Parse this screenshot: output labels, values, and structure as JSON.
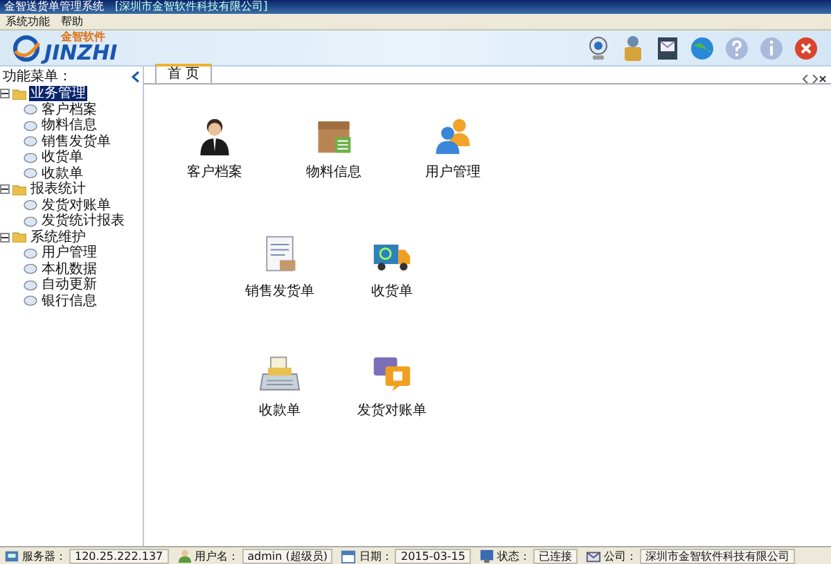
{
  "window": {
    "title": "金智送货单管理系统",
    "company": "[深圳市金智软件科技有限公司]"
  },
  "menu": [
    "系统功能",
    "帮助"
  ],
  "logo": {
    "brand": "金智软件",
    "name": "JINZHI"
  },
  "toolbar": [
    {
      "kind": "camera"
    },
    {
      "kind": "user"
    },
    {
      "kind": "mail"
    },
    {
      "kind": "globe"
    },
    {
      "kind": "help"
    },
    {
      "kind": "info"
    },
    {
      "kind": "close"
    }
  ],
  "sidebar": {
    "title": "功能菜单：",
    "tree": [
      {
        "label": "业务管理",
        "selected": true,
        "expanded": true,
        "children": [
          {
            "label": "客户档案",
            "selected": false
          },
          {
            "label": "物料信息",
            "selected": false
          },
          {
            "label": "销售发货单",
            "selected": false
          },
          {
            "label": "收货单",
            "selected": false
          },
          {
            "label": "收款单",
            "selected": false
          }
        ]
      },
      {
        "label": "报表统计",
        "selected": false,
        "expanded": true,
        "children": [
          {
            "label": "发货对账单",
            "selected": false
          },
          {
            "label": "发货统计报表",
            "selected": false
          }
        ]
      },
      {
        "label": "系统维护",
        "selected": false,
        "expanded": true,
        "children": [
          {
            "label": "用户管理",
            "selected": false
          },
          {
            "label": "本机数据",
            "selected": false
          },
          {
            "label": "自动更新",
            "selected": false
          },
          {
            "label": "银行信息",
            "selected": false
          }
        ]
      }
    ]
  },
  "tabs": [
    {
      "label": "首 页",
      "selected": true
    }
  ],
  "shortcut_rows": [
    {
      "items": [
        {
          "kind": "person",
          "label": "客户档案"
        },
        {
          "kind": "box",
          "label": "物料信息"
        },
        {
          "kind": "users",
          "label": "用户管理"
        }
      ]
    },
    {
      "items": [
        {
          "kind": "document",
          "label": "销售发货单"
        },
        {
          "kind": "truck",
          "label": "收货单"
        }
      ]
    },
    {
      "items": [
        {
          "kind": "register",
          "label": "收款单"
        },
        {
          "kind": "chat",
          "label": "发货对账单"
        }
      ]
    }
  ],
  "status_bar": [
    {
      "kind": "server",
      "label": "服务器：",
      "value": "120.25.222.137"
    },
    {
      "kind": "user",
      "label": "用户名：",
      "value": "admin (超级员)"
    },
    {
      "kind": "date",
      "label": "日期：",
      "value": "2015-03-15"
    },
    {
      "kind": "state",
      "label": "状态：",
      "value": "已连接"
    },
    {
      "kind": "company",
      "label": "公司：",
      "value": "深圳市金智软件科技有限公司"
    }
  ]
}
